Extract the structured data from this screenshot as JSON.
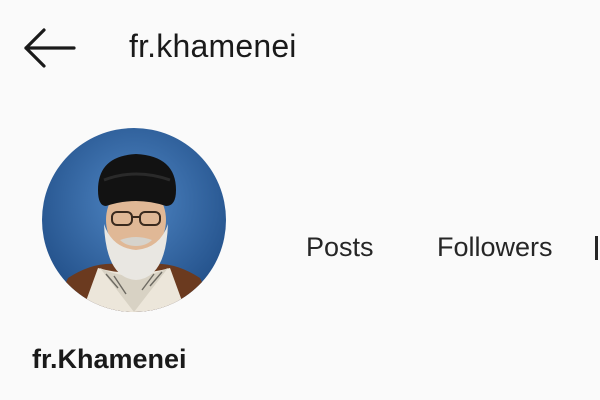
{
  "header": {
    "back_icon": "arrow-left-icon",
    "username": "fr.khamenei"
  },
  "profile": {
    "avatar_icon": "profile-photo",
    "display_name": "fr.Khamenei"
  },
  "stats": {
    "posts_label": "Posts",
    "followers_label": "Followers"
  },
  "colors": {
    "background": "#fafafa",
    "text": "#262626",
    "avatar_background": "#2b5f9e"
  }
}
